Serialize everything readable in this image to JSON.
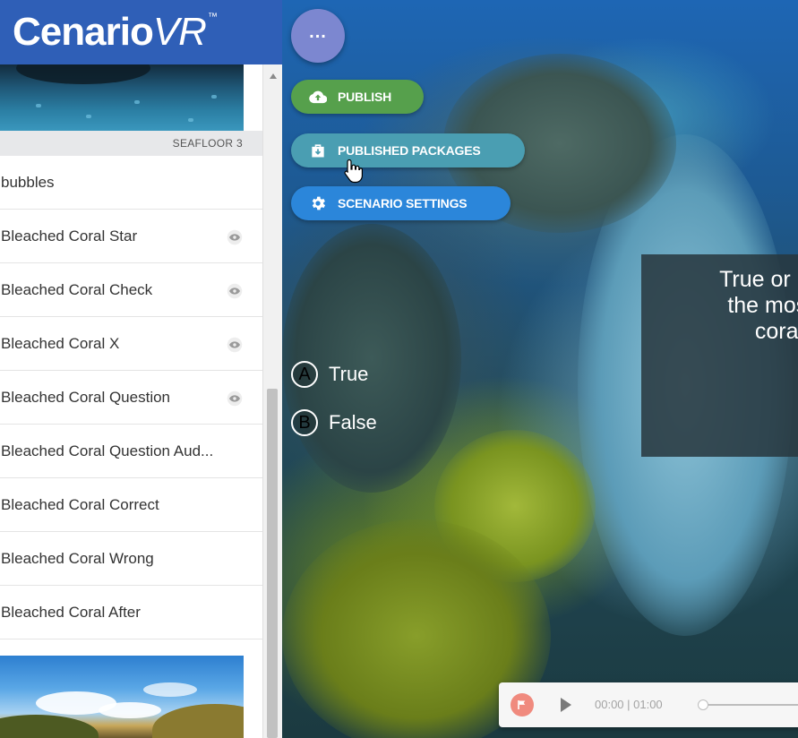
{
  "brand": {
    "name_main": "Cenario",
    "name_vr": "VR",
    "trademark": "™"
  },
  "scene_top": {
    "caption": "SEAFLOOR 3"
  },
  "scene_list": [
    {
      "label": "bubbles",
      "has_eye": false
    },
    {
      "label": "Bleached Coral Star",
      "has_eye": true
    },
    {
      "label": "Bleached Coral Check",
      "has_eye": true
    },
    {
      "label": "Bleached Coral X",
      "has_eye": true
    },
    {
      "label": "Bleached Coral Question",
      "has_eye": true
    },
    {
      "label": "Bleached Coral Question Aud...",
      "has_eye": false
    },
    {
      "label": "Bleached Coral Correct",
      "has_eye": false
    },
    {
      "label": "Bleached Coral Wrong",
      "has_eye": false
    },
    {
      "label": "Bleached Coral After",
      "has_eye": false
    }
  ],
  "toolbar": {
    "more_label": "...",
    "publish_label": "PUBLISH",
    "published_packages_label": "PUBLISHED PACKAGES",
    "scenario_settings_label": "SCENARIO SETTINGS"
  },
  "quiz": {
    "question_lines": [
      "True or Fals",
      "the most c",
      "coral"
    ],
    "options": [
      {
        "letter": "A",
        "text": "True"
      },
      {
        "letter": "B",
        "text": "False"
      }
    ]
  },
  "player": {
    "time": "00:00 | 01:00"
  },
  "colors": {
    "brand_header": "#2f5fb7",
    "publish": "#56a04c",
    "published_packages": "#4a9eb2",
    "scenario_settings": "#2b86da",
    "more_button": "#7c87d0",
    "flag": "#f08a7e"
  },
  "icons": {
    "more": "ellipsis-icon",
    "publish": "cloud-upload-icon",
    "packages": "package-download-icon",
    "settings": "gear-icon",
    "visibility": "eye-icon",
    "flag": "flag-icon",
    "play": "play-icon"
  }
}
